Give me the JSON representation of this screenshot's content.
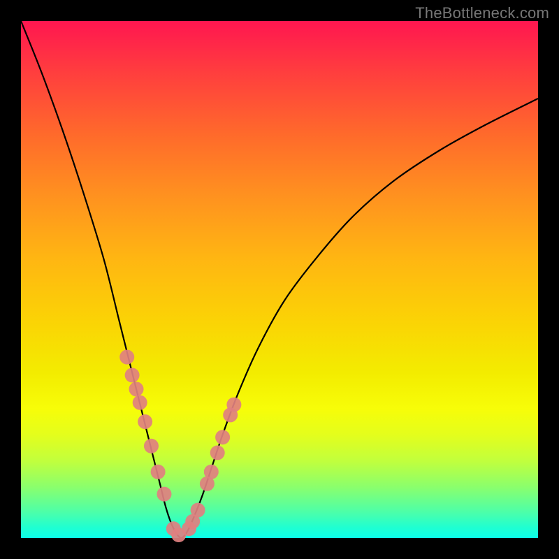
{
  "watermark": "TheBottleneck.com",
  "chart_data": {
    "type": "line",
    "title": "",
    "xlabel": "",
    "ylabel": "",
    "xlim": [
      0,
      100
    ],
    "ylim": [
      0,
      100
    ],
    "series": [
      {
        "name": "bottleneck-curve",
        "x": [
          0,
          4,
          8,
          12,
          16,
          19,
          21,
          23,
          25,
          27,
          28,
          29,
          30,
          31,
          32,
          33,
          35,
          37,
          39,
          42,
          46,
          51,
          57,
          64,
          72,
          81,
          90,
          100
        ],
        "values": [
          100,
          90,
          79,
          67,
          54,
          42,
          34,
          26,
          18,
          10,
          6,
          3,
          1,
          0,
          1,
          3,
          8,
          14,
          20,
          28,
          37,
          46,
          54,
          62,
          69,
          75,
          80,
          85
        ]
      }
    ],
    "marker_points": {
      "name": "highlight-markers",
      "x": [
        20.5,
        21.5,
        22.3,
        23.0,
        24.0,
        25.2,
        26.5,
        27.7,
        29.5,
        30.5,
        32.5,
        33.2,
        34.2,
        36.0,
        36.8,
        38.0,
        39.0,
        40.5,
        41.2
      ],
      "values": [
        35.0,
        31.5,
        28.8,
        26.2,
        22.5,
        17.8,
        12.8,
        8.5,
        1.8,
        0.6,
        1.8,
        3.2,
        5.4,
        10.5,
        12.8,
        16.5,
        19.5,
        23.8,
        25.8
      ]
    },
    "colors": {
      "curve": "#000000",
      "markers": "#E08080",
      "gradient_top": "#FF1650",
      "gradient_bottom": "#0CFFE8"
    }
  }
}
